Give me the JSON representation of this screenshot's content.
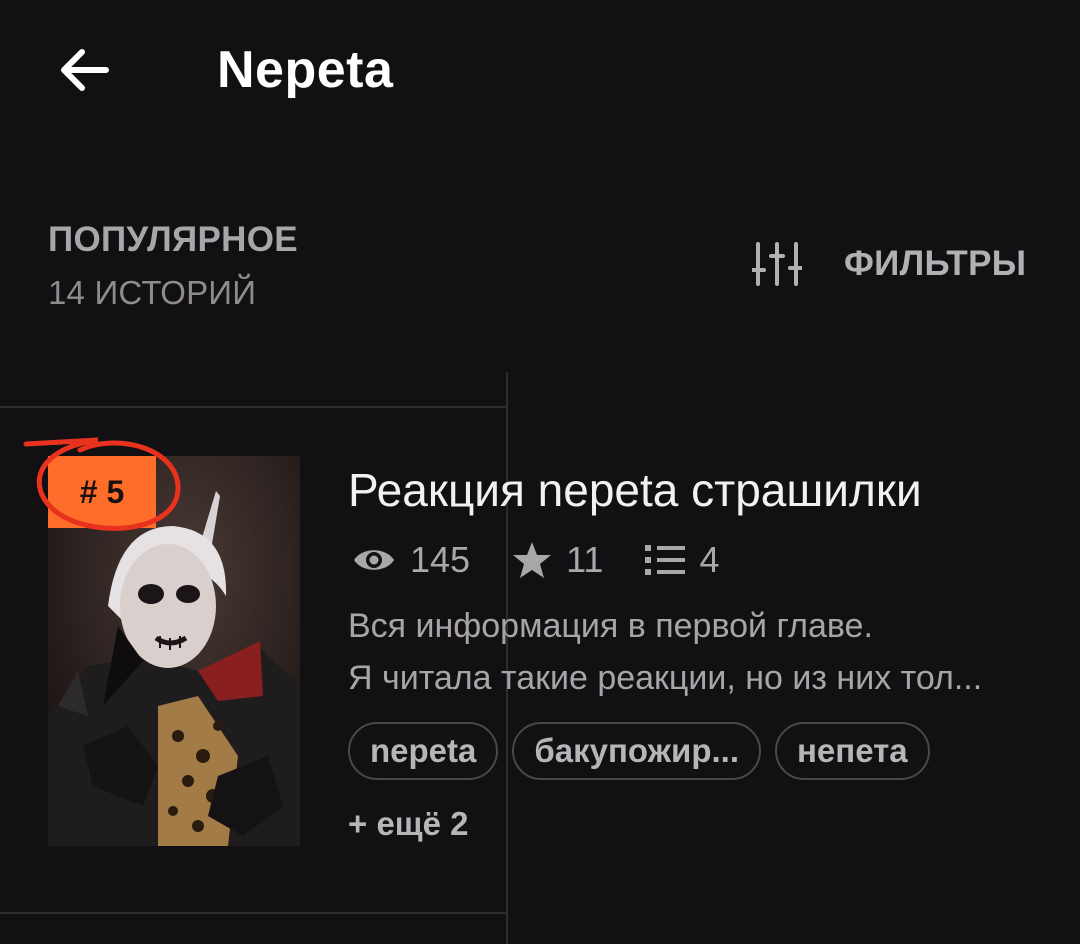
{
  "header": {
    "title": "Nepeta"
  },
  "section": {
    "title": "ПОПУЛЯРНОЕ",
    "count": "14 ИСТОРИЙ",
    "filters_label": "ФИЛЬТРЫ"
  },
  "story": {
    "rank": "# 5",
    "title": "Реакция nepeta страшилки",
    "stats": {
      "views": "145",
      "votes": "11",
      "parts": "4"
    },
    "description": [
      "Вся информация в первой главе.",
      "Я читала такие реакции, но из них тол..."
    ],
    "tags": [
      "nepeta",
      "бакупожир...",
      "непета"
    ],
    "more_tags": "+ ещё 2"
  },
  "colors": {
    "background": "#121013",
    "accent": "#ff6d2a",
    "annotation": "#e8321e"
  },
  "icons": [
    "back-arrow-icon",
    "sliders-icon",
    "eye-icon",
    "star-icon",
    "list-icon"
  ]
}
